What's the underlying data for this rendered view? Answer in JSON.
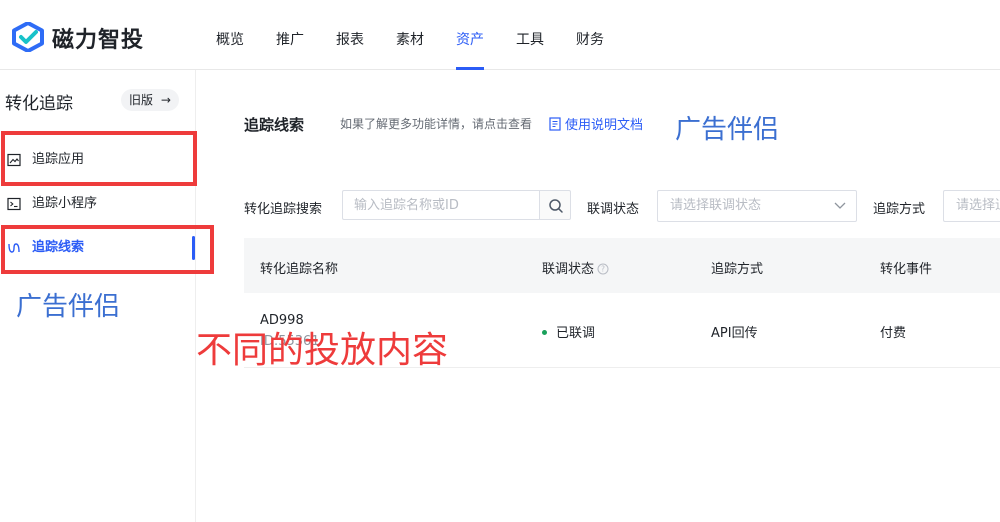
{
  "brand": {
    "name": "磁力智投"
  },
  "nav": {
    "items": [
      {
        "label": "概览"
      },
      {
        "label": "推广"
      },
      {
        "label": "报表"
      },
      {
        "label": "素材"
      },
      {
        "label": "资产"
      },
      {
        "label": "工具"
      },
      {
        "label": "财务"
      }
    ],
    "active": "资产"
  },
  "sidebar": {
    "title": "转化追踪",
    "old_version_label": "旧版",
    "items": [
      {
        "label": "追踪应用",
        "icon": "image-icon"
      },
      {
        "label": "追踪小程序",
        "icon": "terminal-icon"
      },
      {
        "label": "追踪线索",
        "icon": "link-icon",
        "active": true
      }
    ]
  },
  "main": {
    "title": "追踪线索",
    "hint": "如果了解更多功能详情，请点击查看",
    "doc_link": "使用说明文档",
    "filters": {
      "search_label": "转化追踪搜索",
      "search_placeholder": "输入追踪名称或ID",
      "status_label": "联调状态",
      "status_placeholder": "请选择联调状态",
      "method_label": "追踪方式",
      "method_placeholder": "请选择追踪方式"
    },
    "table": {
      "columns": [
        "转化追踪名称",
        "联调状态",
        "追踪方式",
        "转化事件"
      ],
      "rows": [
        {
          "name": "AD998",
          "id": "ID:55361",
          "status": "已联调",
          "method": "API回传",
          "event": "付费"
        }
      ]
    }
  },
  "annotations": {
    "blue_note_top": "广告伴侣",
    "blue_note_left": "广告伴侣",
    "red_note": "不同的投放内容"
  },
  "colors": {
    "accent": "#2b5cf6",
    "annotation_red": "#ee3b3b",
    "annotation_blue": "#3b6fd1",
    "status_green": "#19a05b"
  }
}
